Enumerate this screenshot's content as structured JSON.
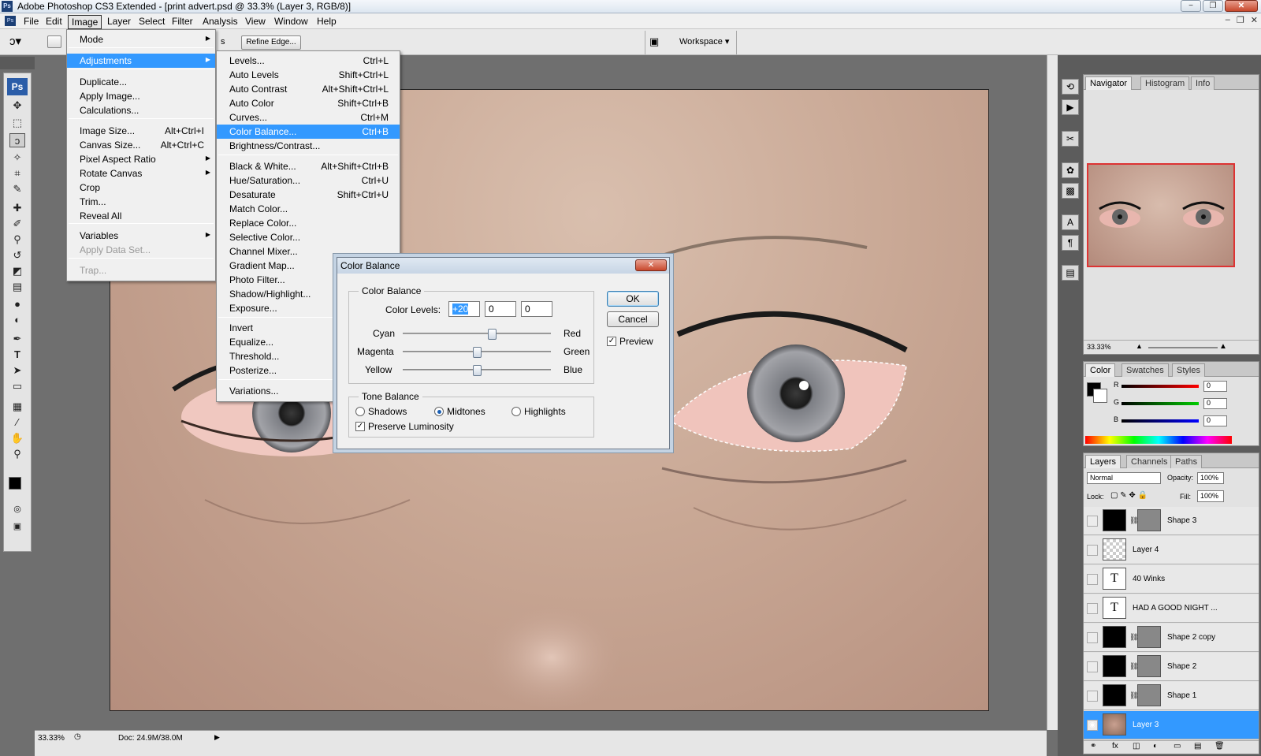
{
  "titlebar": {
    "title": "Adobe Photoshop CS3 Extended - [print advert.psd @ 33.3% (Layer 3, RGB/8)]",
    "logo": "Ps",
    "buttons": [
      "−",
      "❐",
      "✕"
    ]
  },
  "menubar": {
    "items": [
      "File",
      "Edit",
      "Image",
      "Layer",
      "Select",
      "Filter",
      "Analysis",
      "View",
      "Window",
      "Help"
    ],
    "active": "Image",
    "doc_buttons": [
      "–",
      "❐",
      "✕"
    ]
  },
  "options": {
    "refine_edge": "Refine Edge...",
    "workspace": "Workspace ▾",
    "partial": "s"
  },
  "image_menu": {
    "items": [
      {
        "label": "Mode",
        "submenu": true
      },
      {
        "label": "Adjustments",
        "submenu": true,
        "highlight": true
      },
      {
        "label": "Duplicate..."
      },
      {
        "label": "Apply Image..."
      },
      {
        "label": "Calculations..."
      },
      {
        "label": "Image Size...",
        "shortcut": "Alt+Ctrl+I"
      },
      {
        "label": "Canvas Size...",
        "shortcut": "Alt+Ctrl+C"
      },
      {
        "label": "Pixel Aspect Ratio",
        "submenu": true
      },
      {
        "label": "Rotate Canvas",
        "submenu": true
      },
      {
        "label": "Crop"
      },
      {
        "label": "Trim..."
      },
      {
        "label": "Reveal All"
      },
      {
        "label": "Variables",
        "submenu": true
      },
      {
        "label": "Apply Data Set...",
        "disabled": true
      },
      {
        "label": "Trap...",
        "disabled": true
      }
    ]
  },
  "adjust_menu": {
    "items": [
      {
        "label": "Levels...",
        "shortcut": "Ctrl+L"
      },
      {
        "label": "Auto Levels",
        "shortcut": "Shift+Ctrl+L"
      },
      {
        "label": "Auto Contrast",
        "shortcut": "Alt+Shift+Ctrl+L"
      },
      {
        "label": "Auto Color",
        "shortcut": "Shift+Ctrl+B"
      },
      {
        "label": "Curves...",
        "shortcut": "Ctrl+M"
      },
      {
        "label": "Color Balance...",
        "shortcut": "Ctrl+B",
        "highlight": true
      },
      {
        "label": "Brightness/Contrast..."
      },
      {
        "label": "Black & White...",
        "shortcut": "Alt+Shift+Ctrl+B"
      },
      {
        "label": "Hue/Saturation...",
        "shortcut": "Ctrl+U"
      },
      {
        "label": "Desaturate",
        "shortcut": "Shift+Ctrl+U"
      },
      {
        "label": "Match Color..."
      },
      {
        "label": "Replace Color..."
      },
      {
        "label": "Selective Color..."
      },
      {
        "label": "Channel Mixer..."
      },
      {
        "label": "Gradient Map..."
      },
      {
        "label": "Photo Filter..."
      },
      {
        "label": "Shadow/Highlight..."
      },
      {
        "label": "Exposure..."
      },
      {
        "label": "Invert"
      },
      {
        "label": "Equalize..."
      },
      {
        "label": "Threshold..."
      },
      {
        "label": "Posterize..."
      },
      {
        "label": "Variations..."
      }
    ]
  },
  "dialog": {
    "title": "Color Balance",
    "close": "✕",
    "group_label": "Color Balance",
    "levels_label": "Color Levels:",
    "levels": [
      "+20",
      "0",
      "0"
    ],
    "sliders": [
      {
        "left": "Cyan",
        "right": "Red",
        "value": 20
      },
      {
        "left": "Magenta",
        "right": "Green",
        "value": 0
      },
      {
        "left": "Yellow",
        "right": "Blue",
        "value": 0
      }
    ],
    "tone_label": "Tone Balance",
    "tones": [
      "Shadows",
      "Midtones",
      "Highlights"
    ],
    "tone_selected": "Midtones",
    "preserve_luminosity": "Preserve Luminosity",
    "ok": "OK",
    "cancel": "Cancel",
    "preview": "Preview",
    "check": "✓"
  },
  "status": {
    "zoom": "33.33%",
    "doc": "Doc: 24.9M/38.0M"
  },
  "navigator": {
    "tabs": [
      "Navigator",
      "Histogram",
      "Info"
    ],
    "zoom": "33.33%"
  },
  "color_panel": {
    "tabs": [
      "Color",
      "Swatches",
      "Styles"
    ],
    "channels": [
      {
        "name": "R",
        "value": "0"
      },
      {
        "name": "G",
        "value": "0"
      },
      {
        "name": "B",
        "value": "0"
      }
    ]
  },
  "layers_panel": {
    "tabs": [
      "Layers",
      "Channels",
      "Paths"
    ],
    "blend": "Normal",
    "opacity_label": "Opacity:",
    "opacity": "100%",
    "lock_label": "Lock:",
    "fill_label": "Fill:",
    "fill": "100%",
    "layers": [
      {
        "name": "Shape 3",
        "kind": "shape"
      },
      {
        "name": "Layer 4",
        "kind": "empty"
      },
      {
        "name": "40 Winks",
        "kind": "text"
      },
      {
        "name": "HAD A GOOD NIGHT ...",
        "kind": "text"
      },
      {
        "name": "Shape 2 copy",
        "kind": "shape"
      },
      {
        "name": "Shape 2",
        "kind": "shape"
      },
      {
        "name": "Shape 1",
        "kind": "shape"
      },
      {
        "name": "Layer 3",
        "kind": "photo",
        "selected": true
      }
    ]
  },
  "colors": {
    "highlight": "#3399ff",
    "menu_bg": "#f0f0f0",
    "accent": "#2b5da8"
  }
}
